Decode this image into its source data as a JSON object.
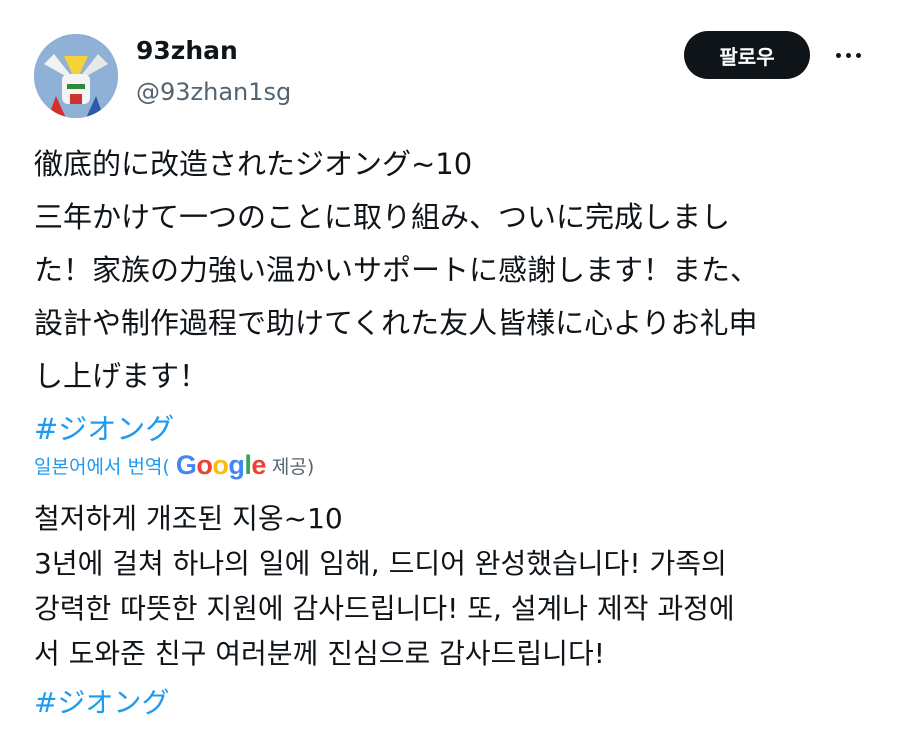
{
  "author": {
    "name": "93zhan",
    "handle": "@93zhan1sg"
  },
  "follow_label": "팔로우",
  "more_icon": "more-dots-icon",
  "tweet": {
    "lines": [
      "徹底的に改造されたジオング~10",
      "三年かけて一つのことに取り組み、ついに完成しまし",
      "た！家族の力強い温かいサポートに感謝します！また、",
      "設計や制作過程で助けてくれた友人皆様に心よりお礼申",
      "し上げます！"
    ],
    "hashtag": "#ジオング"
  },
  "translation": {
    "prefix": "일본어에서 번역(",
    "provider": "Google",
    "suffix": "제공)",
    "lines": [
      "철저하게 개조된 지옹~10",
      "3년에 걸쳐 하나의 일에 임해, 드디어 완성했습니다! 가족의",
      "강력한 따뜻한 지원에 감사드립니다! 또, 설계나 제작 과정에",
      "서 도와준 친구 여러분께 진심으로 감사드립니다!"
    ],
    "hashtag": "#ジオング"
  },
  "colors": {
    "link": "#1d9bf0",
    "text": "#0f1419",
    "secondary": "#536471",
    "follow_bg": "#0f1419",
    "google": [
      "#4285F4",
      "#EA4335",
      "#FBBC05",
      "#4285F4",
      "#34A853",
      "#EA4335"
    ]
  }
}
